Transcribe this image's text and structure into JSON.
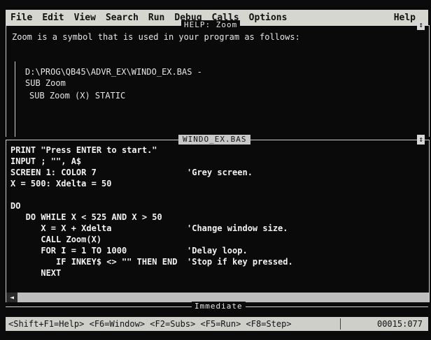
{
  "menu": [
    "File",
    "Edit",
    "View",
    "Search",
    "Run",
    "Debug",
    "Calls",
    "Options"
  ],
  "menu_help": "Help",
  "help_window": {
    "title": "HELP: Zoom",
    "text": "Zoom is a symbol that is used in your program as follows:",
    "tree_path": "D:\\PROG\\QB45\\ADVR_EX\\WINDO_EX.BAS -",
    "tree_sub": "SUB Zoom",
    "tree_decl": "SUB Zoom (X) STATIC"
  },
  "editor": {
    "title": "WINDO_EX.BAS",
    "lines": [
      {
        "code": "PRINT \"Press ENTER to start.\"",
        "comment": ""
      },
      {
        "code": "INPUT ; \"\", A$",
        "comment": ""
      },
      {
        "code": "SCREEN 1: COLOR 7",
        "comment": "'Grey screen."
      },
      {
        "code": "X = 500: Xdelta = 50",
        "comment": ""
      },
      {
        "code": "",
        "comment": ""
      },
      {
        "code": "DO",
        "comment": ""
      },
      {
        "code": "   DO WHILE X < 525 AND X > 50",
        "comment": ""
      },
      {
        "code": "      X = X + Xdelta",
        "comment": "'Change window size."
      },
      {
        "code": "      CALL Zoom(X)",
        "comment": ""
      },
      {
        "code": "      FOR I = 1 TO 1000",
        "comment": "'Delay loop."
      },
      {
        "code": "         IF INKEY$ <> \"\" THEN END",
        "comment": "'Stop if key pressed."
      },
      {
        "code": "      NEXT",
        "comment": ""
      }
    ]
  },
  "immediate": {
    "title": "Immediate"
  },
  "status": {
    "keys": "<Shift+F1=Help> <F6=Window> <F2=Subs> <F5=Run> <F8=Step>",
    "position": "00015:077"
  }
}
